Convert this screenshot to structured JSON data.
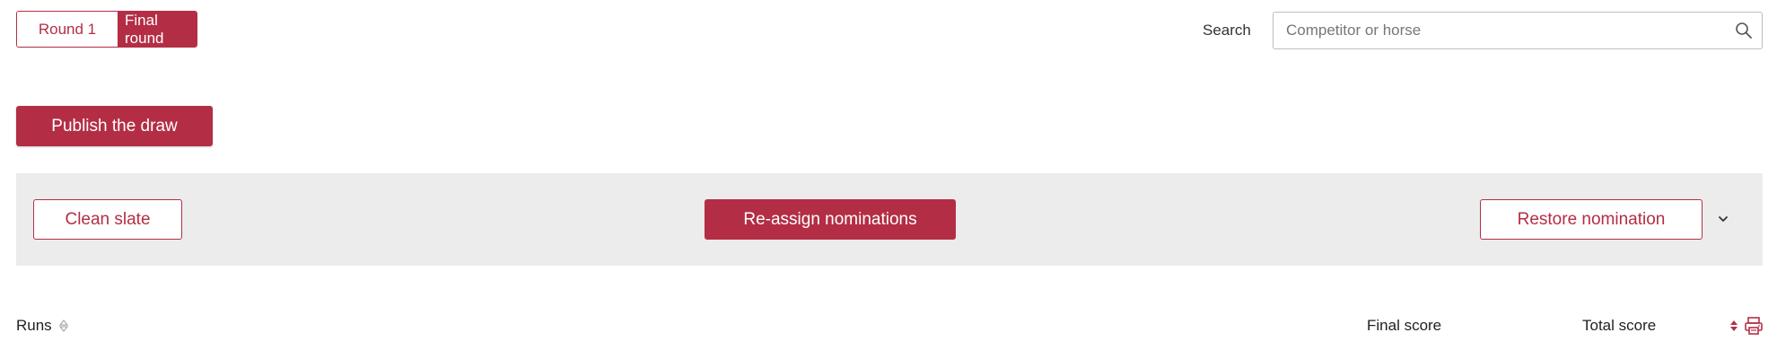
{
  "round_tabs": {
    "round1": "Round 1",
    "final": "Final round",
    "active": "final"
  },
  "search": {
    "label": "Search",
    "placeholder": "Competitor or horse",
    "value": "",
    "icon": "search-icon"
  },
  "actions": {
    "publish": "Publish the draw",
    "clean_slate": "Clean slate",
    "reassign": "Re-assign nominations",
    "restore": "Restore nomination"
  },
  "table": {
    "columns": {
      "runs": "Runs",
      "final_score": "Final score",
      "total_score": "Total score"
    }
  },
  "colors": {
    "accent": "#b32e45",
    "band": "#ececec",
    "text": "#222222"
  }
}
